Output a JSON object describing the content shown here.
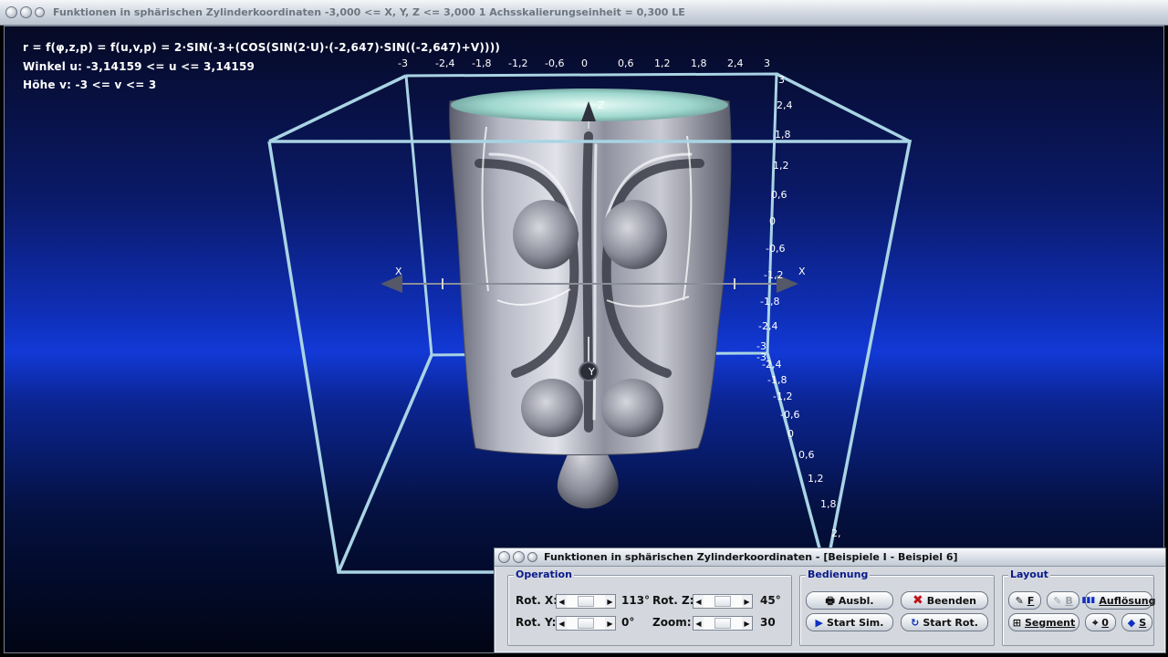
{
  "window": {
    "title": "Funktionen in sphärischen Zylinderkoordinaten   -3,000 <= X, Y, Z <= 3,000    1 Achsskalierungseinheit = 0,300 LE"
  },
  "info": {
    "formula": "r = f(φ,z,p) = f(u,v,p) = 2·SIN(-3+(COS(SIN(2·U)·(-2,647)·SIN((-2,647)+V))))",
    "winkel": "Winkel u: -3,14159 <= u <= 3,14159",
    "hoehe": "Höhe v: -3 <= v <= 3"
  },
  "axes": {
    "x_label": "X",
    "y_label": "Y",
    "z_label": "Z",
    "top_ticks": [
      "-3",
      "-2,4",
      "-1,8",
      "-1,2",
      "-0,6",
      "0",
      "0,6",
      "1,2",
      "1,8",
      "2,4",
      "3"
    ],
    "right_ticks": [
      "3",
      "2,4",
      "1,8",
      "1,2",
      "0,6",
      "0",
      "-0,6",
      "-1,2",
      "-1,8",
      "-2,4",
      "-3"
    ],
    "diag_ticks": [
      "-3",
      "-2,4",
      "-1,8",
      "-1,2",
      "-0,6",
      "0",
      "0,6",
      "1,2",
      "1,8",
      "2,"
    ]
  },
  "panel": {
    "title": "Funktionen in sphärischen Zylinderkoordinaten - [Beispiele I - Beispiel 6]",
    "operation": {
      "label": "Operation",
      "rot_x_label": "Rot. X:",
      "rot_x_value": "113°",
      "rot_y_label": "Rot. Y:",
      "rot_y_value": "0°",
      "rot_z_label": "Rot. Z:",
      "rot_z_value": "45°",
      "zoom_label": "Zoom:",
      "zoom_value": "30"
    },
    "bedienung": {
      "label": "Bedienung",
      "ausbl": "Ausbl.",
      "beenden": "Beenden",
      "start_sim": "Start Sim.",
      "start_rot": "Start Rot."
    },
    "layout": {
      "label": "Layout",
      "f": "F",
      "b": "B",
      "aufloesung": "Auflösung",
      "segment": "Segment",
      "zero": "0",
      "s": "S"
    }
  },
  "colors": {
    "box_edge": "#a9d4e4",
    "surface": "#9a9cab",
    "accent_label": "#0a1a8a"
  }
}
